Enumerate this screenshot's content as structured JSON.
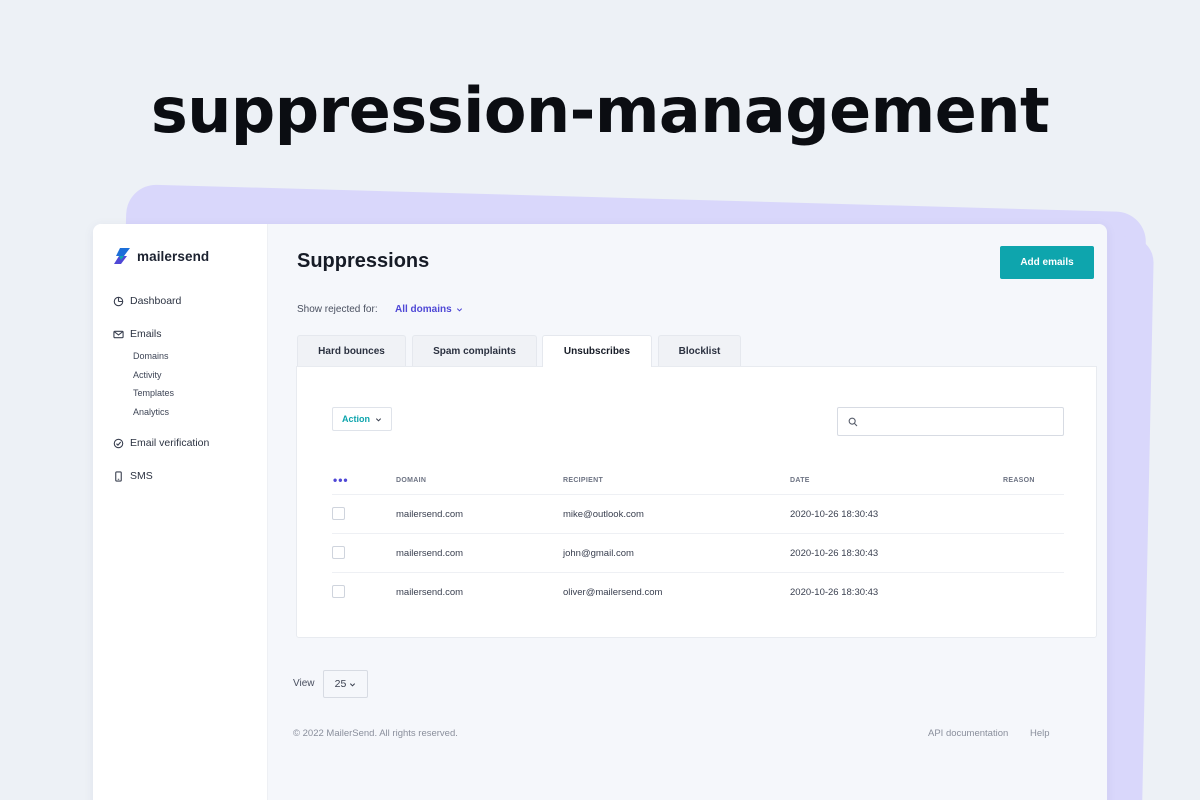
{
  "hero": {
    "title": "suppression-management"
  },
  "brand": {
    "name": "mailersend",
    "accent": "#0ea5ad",
    "link_color": "#4f48d6"
  },
  "sidebar": {
    "items": [
      {
        "label": "Dashboard",
        "icon": "dashboard-icon"
      },
      {
        "label": "Emails",
        "icon": "mail-icon"
      },
      {
        "label": "Email verification",
        "icon": "check-circle-icon"
      },
      {
        "label": "SMS",
        "icon": "phone-icon"
      }
    ],
    "email_subitems": [
      "Domains",
      "Activity",
      "Templates",
      "Analytics"
    ]
  },
  "main": {
    "title": "Suppressions",
    "add_button": "Add emails",
    "filter_label": "Show rejected for:",
    "filter_value": "All domains",
    "tabs": [
      {
        "label": "Hard bounces",
        "active": false
      },
      {
        "label": "Spam complaints",
        "active": false
      },
      {
        "label": "Unsubscribes",
        "active": true
      },
      {
        "label": "Blocklist",
        "active": false
      }
    ],
    "action_button": "Action",
    "search_placeholder": "",
    "table": {
      "more_icon": "•••",
      "columns": [
        "DOMAIN",
        "RECIPIENT",
        "DATE",
        "REASON"
      ],
      "rows": [
        {
          "domain": "mailersend.com",
          "recipient": "mike@outlook.com",
          "date": "2020-10-26 18:30:43",
          "reason": ""
        },
        {
          "domain": "mailersend.com",
          "recipient": "john@gmail.com",
          "date": "2020-10-26 18:30:43",
          "reason": ""
        },
        {
          "domain": "mailersend.com",
          "recipient": "oliver@mailersend.com",
          "date": "2020-10-26 18:30:43",
          "reason": ""
        }
      ]
    },
    "pagination": {
      "view_label": "View",
      "per_page": "25"
    }
  },
  "footer": {
    "copyright": "© 2022 MailerSend. All rights reserved.",
    "links": [
      "API documentation",
      "Help"
    ]
  }
}
